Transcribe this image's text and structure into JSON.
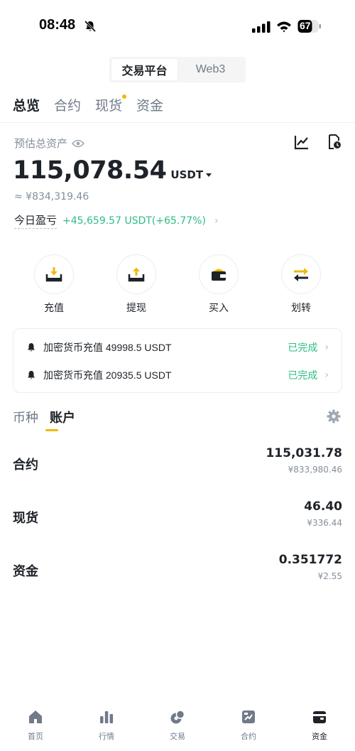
{
  "status_bar": {
    "time": "08:48",
    "battery": "67"
  },
  "platform_toggle": {
    "exchange": "交易平台",
    "web3": "Web3"
  },
  "top_tabs": [
    {
      "label": "总览"
    },
    {
      "label": "合约"
    },
    {
      "label": "现货"
    },
    {
      "label": "资金"
    }
  ],
  "balance": {
    "label": "预估总资产",
    "amount": "115,078.54",
    "unit": "USDT",
    "fiat": "≈ ¥834,319.46",
    "pnl_label": "今日盈亏",
    "pnl_value": "+45,659.57 USDT(+65.77%)",
    "pnl_arrow": "›"
  },
  "actions": [
    {
      "label": "充值",
      "icon": "deposit-icon"
    },
    {
      "label": "提现",
      "icon": "withdraw-icon"
    },
    {
      "label": "买入",
      "icon": "buy-wallet-icon"
    },
    {
      "label": "划转",
      "icon": "transfer-icon"
    }
  ],
  "notices": [
    {
      "text": "加密货币充值 49998.5 USDT",
      "status": "已完成",
      "arrow": "›"
    },
    {
      "text": "加密货币充值 20935.5 USDT",
      "status": "已完成",
      "arrow": "›"
    }
  ],
  "sub_tabs": [
    {
      "label": "币种"
    },
    {
      "label": "账户"
    }
  ],
  "accounts": [
    {
      "name": "合约",
      "amount": "115,031.78",
      "fiat": "¥833,980.46"
    },
    {
      "name": "现货",
      "amount": "46.40",
      "fiat": "¥336.44"
    },
    {
      "name": "资金",
      "amount": "0.351772",
      "fiat": "¥2.55"
    }
  ],
  "bottom_nav": [
    {
      "label": "首页",
      "icon": "home-icon"
    },
    {
      "label": "行情",
      "icon": "markets-icon"
    },
    {
      "label": "交易",
      "icon": "trade-icon"
    },
    {
      "label": "合约",
      "icon": "futures-icon"
    },
    {
      "label": "资金",
      "icon": "wallet-icon"
    }
  ],
  "colors": {
    "accent": "#f0b90b",
    "positive": "#2ebd85",
    "text": "#1e2329",
    "muted": "#848e9c"
  }
}
